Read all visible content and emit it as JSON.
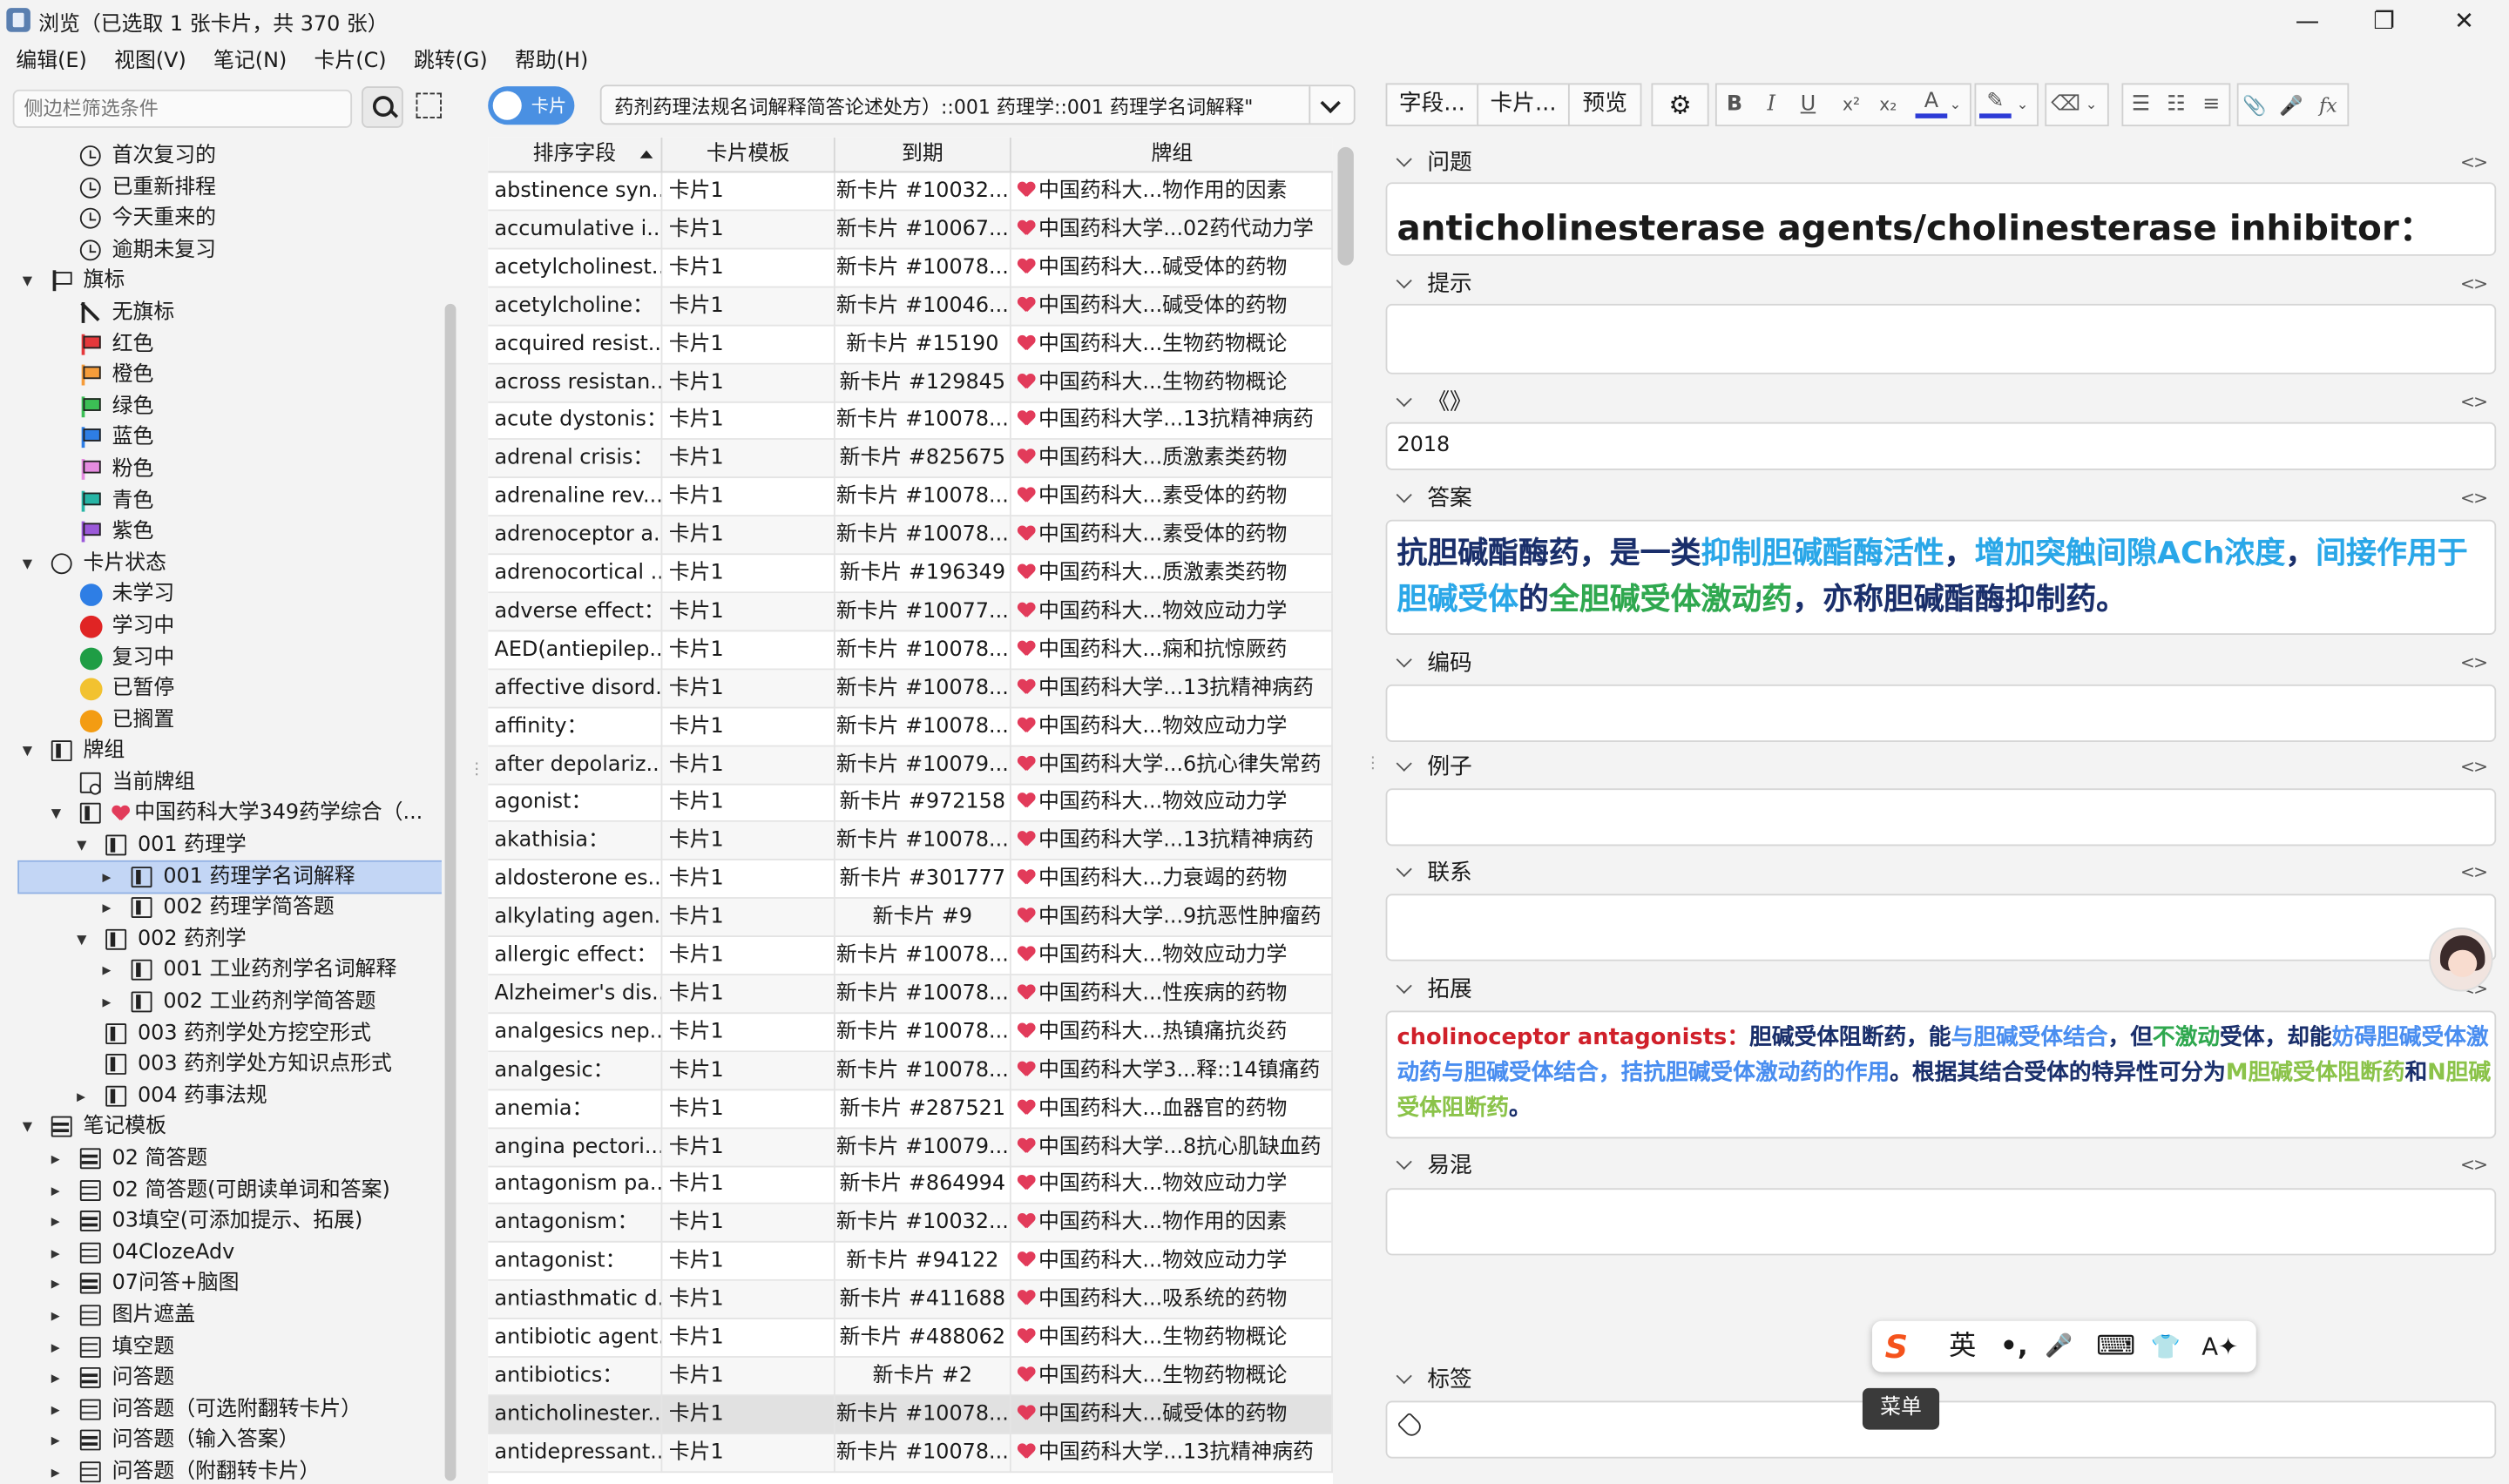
{
  "window": {
    "title": "浏览（已选取 1 张卡片，共 370 张）",
    "controls": {
      "minimize": "—",
      "maximize": "❐",
      "close": "✕"
    }
  },
  "menu": [
    "编辑(E)",
    "视图(V)",
    "笔记(N)",
    "卡片(C)",
    "跳转(G)",
    "帮助(H)"
  ],
  "sidebar": {
    "search_placeholder": "侧边栏筛选条件",
    "tree": [
      {
        "label": "首次复习的",
        "icon": "clock-icon",
        "level": 2
      },
      {
        "label": "已重新排程",
        "icon": "clock-icon",
        "level": 2
      },
      {
        "label": "今天重来的",
        "icon": "clock-icon",
        "level": 2
      },
      {
        "label": "逾期未复习",
        "icon": "clock-icon",
        "level": 2
      },
      {
        "label": "旗标",
        "icon": "flag-icon",
        "level": 1,
        "toggle": "v"
      },
      {
        "label": "无旗标",
        "icon": "no-flag-icon",
        "level": 2
      },
      {
        "label": "红色",
        "icon": "flag-icon",
        "color": "#e5383b",
        "level": 2
      },
      {
        "label": "橙色",
        "icon": "flag-icon",
        "color": "#f59c3a",
        "level": 2
      },
      {
        "label": "绿色",
        "icon": "flag-icon",
        "color": "#3cbf55",
        "level": 2
      },
      {
        "label": "蓝色",
        "icon": "flag-icon",
        "color": "#2e7ee5",
        "level": 2
      },
      {
        "label": "粉色",
        "icon": "flag-icon",
        "color": "#e58be0",
        "level": 2
      },
      {
        "label": "青色",
        "icon": "flag-icon",
        "color": "#27b5a5",
        "level": 2
      },
      {
        "label": "紫色",
        "icon": "flag-icon",
        "color": "#9b59d9",
        "level": 2
      },
      {
        "label": "卡片状态",
        "icon": "circle-icon",
        "level": 1,
        "toggle": "v"
      },
      {
        "label": "未学习",
        "icon": "dot-icon",
        "color": "#2e7ee5",
        "level": 2
      },
      {
        "label": "学习中",
        "icon": "dot-icon",
        "color": "#e02424",
        "level": 2
      },
      {
        "label": "复习中",
        "icon": "dot-icon",
        "color": "#1f9d45",
        "level": 2
      },
      {
        "label": "已暂停",
        "icon": "dot-icon",
        "color": "#f2c230",
        "level": 2
      },
      {
        "label": "已搁置",
        "icon": "dot-icon",
        "color": "#f39c12",
        "level": 2
      },
      {
        "label": "牌组",
        "icon": "deck-icon",
        "level": 1,
        "toggle": "v"
      },
      {
        "label": "当前牌组",
        "icon": "current-deck-icon",
        "level": 2
      },
      {
        "label": "中国药科大学349药学综合（...",
        "icon": "deck-icon",
        "level": 2,
        "toggle": "v",
        "heart": true
      },
      {
        "label": "001 药理学",
        "icon": "deck-icon",
        "level": 3,
        "toggle": "v"
      },
      {
        "label": "001 药理学名词解释",
        "icon": "deck-icon",
        "level": 4,
        "toggle": ">",
        "selected": true
      },
      {
        "label": "002 药理学简答题",
        "icon": "deck-icon",
        "level": 4,
        "toggle": ">"
      },
      {
        "label": "002 药剂学",
        "icon": "deck-icon",
        "level": 3,
        "toggle": "v"
      },
      {
        "label": "001 工业药剂学名词解释",
        "icon": "deck-icon",
        "level": 4,
        "toggle": ">"
      },
      {
        "label": "002 工业药剂学简答题",
        "icon": "deck-icon",
        "level": 4,
        "toggle": ">"
      },
      {
        "label": "003 药剂学处方挖空形式",
        "icon": "deck-icon",
        "level": 3
      },
      {
        "label": "003 药剂学处方知识点形式",
        "icon": "deck-icon",
        "level": 3
      },
      {
        "label": "004 药事法规",
        "icon": "deck-icon",
        "level": 3,
        "toggle": ">"
      },
      {
        "label": "笔记模板",
        "icon": "note-type-icon",
        "level": 1,
        "toggle": "v"
      },
      {
        "label": "02 简答题",
        "icon": "note-type-icon",
        "level": 2,
        "toggle": ">"
      },
      {
        "label": "02 简答题(可朗读单词和答案)",
        "icon": "note-type-icon",
        "level": 2,
        "toggle": ">"
      },
      {
        "label": "03填空(可添加提示、拓展)",
        "icon": "note-type-icon",
        "level": 2,
        "toggle": ">"
      },
      {
        "label": "04ClozeAdv",
        "icon": "note-type-icon",
        "level": 2,
        "toggle": ">"
      },
      {
        "label": "07问答+脑图",
        "icon": "note-type-icon",
        "level": 2,
        "toggle": ">"
      },
      {
        "label": "图片遮盖",
        "icon": "note-type-icon",
        "level": 2,
        "toggle": ">"
      },
      {
        "label": "填空题",
        "icon": "note-type-icon",
        "level": 2,
        "toggle": ">"
      },
      {
        "label": "问答题",
        "icon": "note-type-icon",
        "level": 2,
        "toggle": ">"
      },
      {
        "label": "问答题（可选附翻转卡片）",
        "icon": "note-type-icon",
        "level": 2,
        "toggle": ">"
      },
      {
        "label": "问答题（输入答案）",
        "icon": "note-type-icon",
        "level": 2,
        "toggle": ">"
      },
      {
        "label": "问答题（附翻转卡片）",
        "icon": "note-type-icon",
        "level": 2,
        "toggle": ">"
      }
    ]
  },
  "browser": {
    "toggle_label": "卡片",
    "query": "药剂药理法规名词解释简答论述处方）::001 药理学::001 药理学名词解释\"",
    "columns": [
      "排序字段",
      "卡片模板",
      "到期",
      "牌组"
    ],
    "rows": [
      [
        "abstinence syn...",
        "卡片1",
        "新卡片 #10032...",
        "中国药科大...物作用的因素"
      ],
      [
        "accumulative i...",
        "卡片1",
        "新卡片 #10067...",
        "中国药科大学...02药代动力学"
      ],
      [
        "acetylcholinest...",
        "卡片1",
        "新卡片 #10078...",
        "中国药科大...碱受体的药物"
      ],
      [
        "acetylcholine：",
        "卡片1",
        "新卡片 #10046...",
        "中国药科大...碱受体的药物"
      ],
      [
        "acquired resist...",
        "卡片1",
        "新卡片 #15190",
        "中国药科大...生物药物概论"
      ],
      [
        "across resistan...",
        "卡片1",
        "新卡片 #129845",
        "中国药科大...生物药物概论"
      ],
      [
        "acute dystonis：",
        "卡片1",
        "新卡片 #10078...",
        "中国药科大学...13抗精神病药"
      ],
      [
        "adrenal crisis：",
        "卡片1",
        "新卡片 #825675",
        "中国药科大...质激素类药物"
      ],
      [
        "adrenaline rev...",
        "卡片1",
        "新卡片 #10078...",
        "中国药科大...素受体的药物"
      ],
      [
        "adrenoceptor a...",
        "卡片1",
        "新卡片 #10078...",
        "中国药科大...素受体的药物"
      ],
      [
        "adrenocortical ...",
        "卡片1",
        "新卡片 #196349",
        "中国药科大...质激素类药物"
      ],
      [
        "adverse effect：",
        "卡片1",
        "新卡片 #10077...",
        "中国药科大...物效应动力学"
      ],
      [
        "AED(antiepilep...",
        "卡片1",
        "新卡片 #10078...",
        "中国药科大...痫和抗惊厥药"
      ],
      [
        "affective disord...",
        "卡片1",
        "新卡片 #10078...",
        "中国药科大学...13抗精神病药"
      ],
      [
        "affinity：",
        "卡片1",
        "新卡片 #10078...",
        "中国药科大...物效应动力学"
      ],
      [
        "after depolariz...",
        "卡片1",
        "新卡片 #10079...",
        "中国药科大学...6抗心律失常药"
      ],
      [
        "agonist：",
        "卡片1",
        "新卡片 #972158",
        "中国药科大...物效应动力学"
      ],
      [
        "akathisia：",
        "卡片1",
        "新卡片 #10078...",
        "中国药科大学...13抗精神病药"
      ],
      [
        "aldosterone es...",
        "卡片1",
        "新卡片 #301777",
        "中国药科大...力衰竭的药物"
      ],
      [
        "alkylating agen...",
        "卡片1",
        "新卡片 #9",
        "中国药科大学...9抗恶性肿瘤药"
      ],
      [
        "allergic effect：",
        "卡片1",
        "新卡片 #10078...",
        "中国药科大...物效应动力学"
      ],
      [
        "Alzheimer's dis...",
        "卡片1",
        "新卡片 #10078...",
        "中国药科大...性疾病的药物"
      ],
      [
        "analgesics nep...",
        "卡片1",
        "新卡片 #10078...",
        "中国药科大...热镇痛抗炎药"
      ],
      [
        "analgesic：",
        "卡片1",
        "新卡片 #10078...",
        "中国药科大学3...释::14镇痛药"
      ],
      [
        "anemia：",
        "卡片1",
        "新卡片 #287521",
        "中国药科大...血器官的药物"
      ],
      [
        "angina pectori...",
        "卡片1",
        "新卡片 #10079...",
        "中国药科大学...8抗心肌缺血药"
      ],
      [
        "antagonism pa...",
        "卡片1",
        "新卡片 #864994",
        "中国药科大...物效应动力学"
      ],
      [
        "antagonism：",
        "卡片1",
        "新卡片 #10032...",
        "中国药科大...物作用的因素"
      ],
      [
        "antagonist：",
        "卡片1",
        "新卡片 #94122",
        "中国药科大...物效应动力学"
      ],
      [
        "antiasthmatic d...",
        "卡片1",
        "新卡片 #411688",
        "中国药科大...吸系统的药物"
      ],
      [
        "antibiotic agent...",
        "卡片1",
        "新卡片 #488062",
        "中国药科大...生物药物概论"
      ],
      [
        "antibiotics：",
        "卡片1",
        "新卡片 #2",
        "中国药科大...生物药物概论"
      ],
      [
        "anticholinester...",
        "卡片1",
        "新卡片 #10078...",
        "中国药科大...碱受体的药物"
      ],
      [
        "antidepressant...",
        "卡片1",
        "新卡片 #10078...",
        "中国药科大学...13抗精神病药"
      ]
    ],
    "selected_row": 32
  },
  "editor": {
    "toolbar": {
      "fields": "字段...",
      "cards": "卡片...",
      "preview": "预览",
      "gear": "⚙",
      "bold": "B",
      "italic": "I",
      "underline": "U",
      "sup": "x²",
      "sub": "x₂",
      "text_color": "A",
      "highlight": "✎",
      "eraser": "⌫",
      "ul": "☰",
      "ol": "☷",
      "align": "≡",
      "attach": "📎",
      "mic": "🎤",
      "formula": "fx"
    },
    "fields": {
      "question": {
        "name": "问题",
        "value": "anticholinesterase agents/cholinesterase inhibitor："
      },
      "hint": {
        "name": "提示",
        "value": ""
      },
      "source": {
        "name": "《》",
        "value": "2018"
      },
      "answer": {
        "name": "答案",
        "segments": [
          {
            "t": "抗胆碱酯酶药，是一类",
            "c": "dnavy"
          },
          {
            "t": "抑制胆碱酯酶活性",
            "c": "blue"
          },
          {
            "t": "，",
            "c": "dnavy"
          },
          {
            "t": "增加突触间隙ACh浓度",
            "c": "blue"
          },
          {
            "t": "，",
            "c": "dnavy"
          },
          {
            "t": "间接作用于胆碱受体",
            "c": "blue"
          },
          {
            "t": "的",
            "c": "dnavy"
          },
          {
            "t": "全胆碱受体激动药",
            "c": "green"
          },
          {
            "t": "，亦称胆碱酯酶抑制药。",
            "c": "dnavy"
          }
        ]
      },
      "code": {
        "name": "编码",
        "value": ""
      },
      "example": {
        "name": "例子",
        "value": ""
      },
      "relation": {
        "name": "联系",
        "value": ""
      },
      "extension": {
        "name": "拓展",
        "segments": [
          {
            "t": "cholinoceptor antagonists：",
            "c": "red"
          },
          {
            "t": "胆碱受体阻断药，能",
            "c": "dnavy"
          },
          {
            "t": "与胆碱受体结合",
            "c": "lblue"
          },
          {
            "t": "，但",
            "c": "dnavy"
          },
          {
            "t": "不激动",
            "c": "green"
          },
          {
            "t": "受体，却能",
            "c": "dnavy"
          },
          {
            "t": "妨碍胆碱受体激动药与胆碱受体结合，拮抗胆碱受体激动药的作用",
            "c": "lblue"
          },
          {
            "t": "。根据其结合受体的特异性可分为",
            "c": "dnavy"
          },
          {
            "t": "M胆碱受体阻断药",
            "c": "lgreen"
          },
          {
            "t": "和",
            "c": "dnavy"
          },
          {
            "t": "N胆碱受体阻断药",
            "c": "lgreen"
          },
          {
            "t": "。",
            "c": "dnavy"
          }
        ]
      },
      "confusion": {
        "name": "易混",
        "value": ""
      },
      "tags": {
        "name": "标签",
        "value": ""
      }
    },
    "code_toggle": "<>"
  },
  "ime": {
    "keys": [
      "S",
      "英",
      "•,",
      "🎤",
      "⌨",
      "👕",
      "A✦"
    ],
    "tooltip": "菜单"
  }
}
